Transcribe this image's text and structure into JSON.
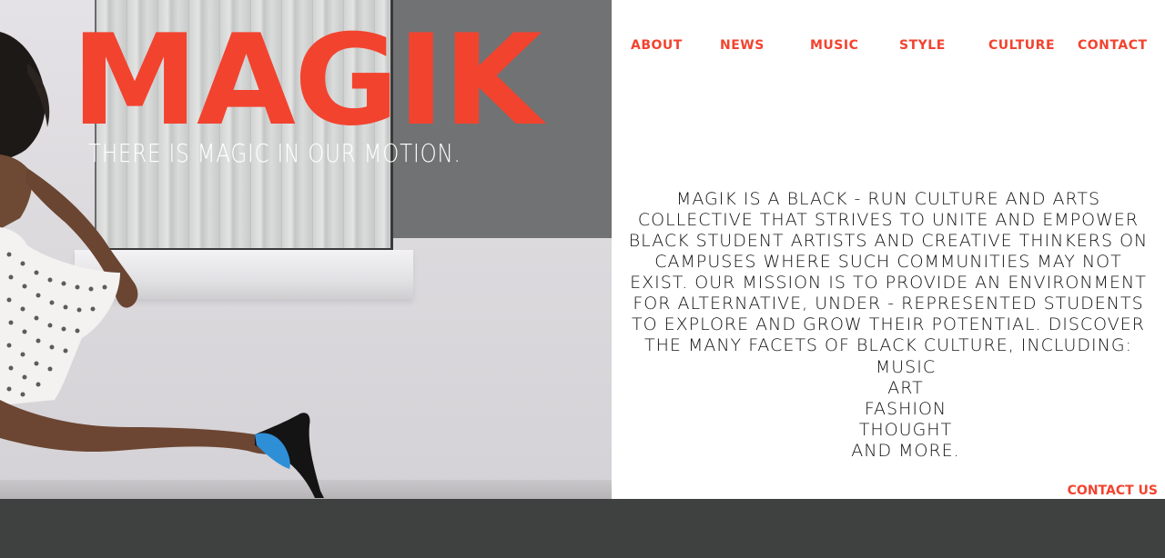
{
  "brand": {
    "logo_text": "MAGIK",
    "tagline": "THERE IS MAGIC IN OUR MOTION.",
    "accent_color": "#f2432f"
  },
  "nav": {
    "items": [
      {
        "label": "ABOUT"
      },
      {
        "label": "NEWS"
      },
      {
        "label": "MUSIC"
      },
      {
        "label": "STYLE"
      },
      {
        "label": "CULTURE"
      },
      {
        "label": "CONTACT"
      }
    ]
  },
  "about": {
    "description": "MAGIK IS A BLACK - RUN CULTURE AND ARTS COLLECTIVE THAT STRIVES TO UNITE AND EMPOWER BLACK STUDENT ARTISTS AND CREATIVE THINKERS ON CAMPUSES WHERE SUCH COMMUNITIES MAY NOT EXIST. OUR MISSION IS TO PROVIDE AN ENVIRONMENT FOR ALTERNATIVE, UNDER - REPRESENTED STUDENTS TO EXPLORE AND GROW THEIR POTENTIAL. DISCOVER THE MANY FACETS OF BLACK CULTURE, INCLUDING:",
    "facets": [
      "MUSIC",
      "ART",
      "FASHION",
      "THOUGHT",
      "AND MORE."
    ]
  },
  "contact_us_label": "CONTACT US",
  "footer": {
    "background_color": "#3f4140"
  }
}
